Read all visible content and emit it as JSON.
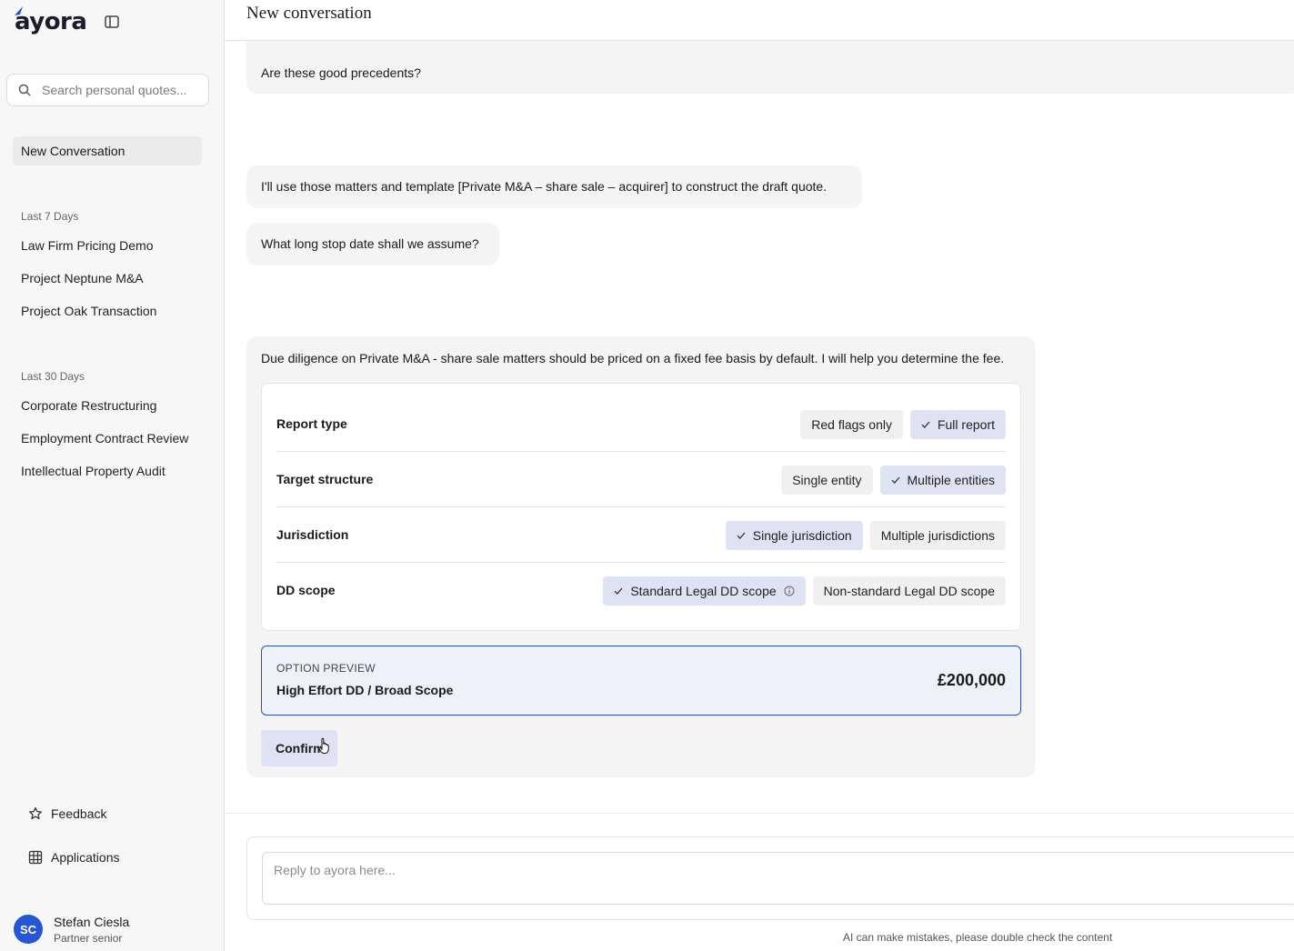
{
  "sidebar": {
    "logo": "ayora",
    "search_placeholder": "Search personal quotes...",
    "new_conversation": "New Conversation",
    "sections": [
      {
        "label": "Last 7 Days",
        "items": [
          "Law Firm Pricing Demo",
          "Project Neptune M&A",
          "Project Oak Transaction"
        ]
      },
      {
        "label": "Last 30 Days",
        "items": [
          "Corporate Restructuring",
          "Employment Contract Review",
          "Intellectual Property Audit"
        ]
      }
    ],
    "footer": {
      "feedback": "Feedback",
      "applications": "Applications"
    },
    "user": {
      "initials": "SC",
      "name": "Stefan Ciesla",
      "role": "Partner senior"
    }
  },
  "header": {
    "title": "New conversation"
  },
  "messages": {
    "m1": "Are these good precedents?",
    "m2": "I'll use those matters and template [Private M&A – share sale – acquirer] to construct the draft quote.",
    "m3": "What long stop date shall we assume?",
    "m4": "Due diligence on Private M&A - share sale matters should be priced on a fixed fee basis by default. I will help you determine the fee."
  },
  "options": {
    "rows": [
      {
        "label": "Report type",
        "chips": [
          {
            "text": "Red flags only",
            "selected": false
          },
          {
            "text": "Full report",
            "selected": true
          }
        ]
      },
      {
        "label": "Target structure",
        "chips": [
          {
            "text": "Single entity",
            "selected": false
          },
          {
            "text": "Multiple entities",
            "selected": true
          }
        ]
      },
      {
        "label": "Jurisdiction",
        "chips": [
          {
            "text": "Single jurisdiction",
            "selected": true
          },
          {
            "text": "Multiple jurisdictions",
            "selected": false
          }
        ]
      },
      {
        "label": "DD scope",
        "chips": [
          {
            "text": "Standard Legal DD scope",
            "selected": true,
            "info": true
          },
          {
            "text": "Non-standard Legal DD scope",
            "selected": false
          }
        ]
      }
    ]
  },
  "preview": {
    "label": "OPTION PREVIEW",
    "name": "High Effort DD / Broad Scope",
    "price": "£200,000"
  },
  "confirm_label": "Confirm",
  "composer": {
    "placeholder": "Reply to ayora here..."
  },
  "disclaimer": "AI can make mistakes, please double check the content",
  "colors": {
    "accent": "#2a55b8",
    "selected_chip": "#dfe2f3",
    "avatar": "#2456d6"
  }
}
